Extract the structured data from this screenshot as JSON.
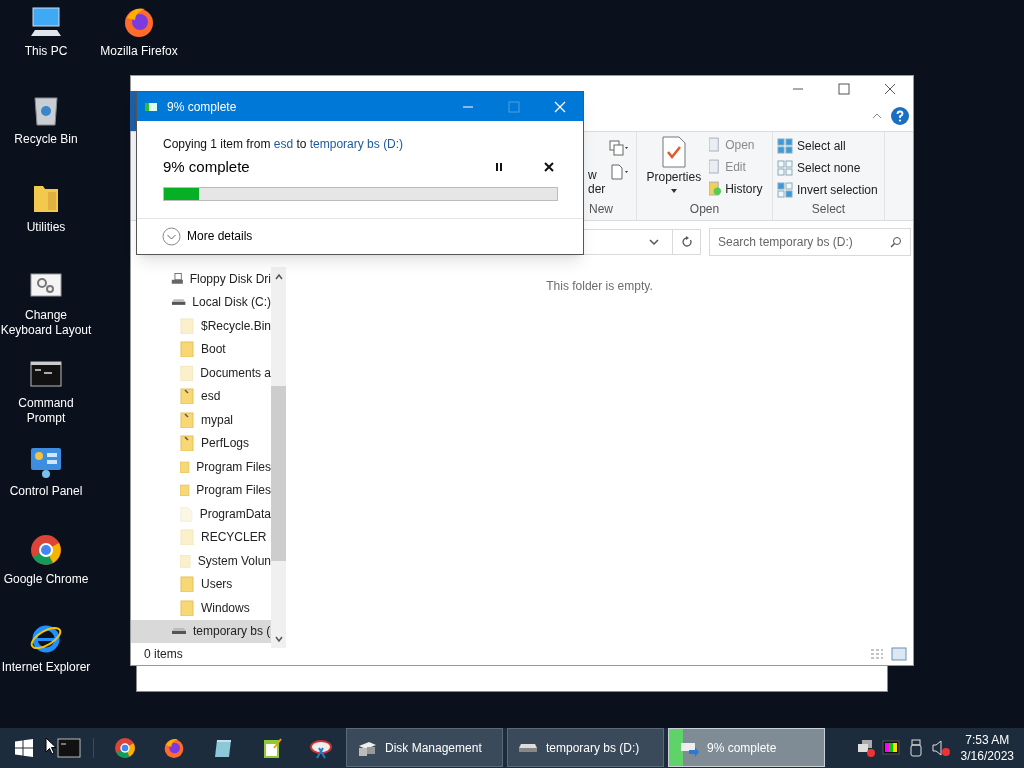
{
  "desktop_icons": [
    {
      "label": "This PC",
      "kind": "pc"
    },
    {
      "label": "Recycle Bin",
      "kind": "recycle"
    },
    {
      "label": "Utilities",
      "kind": "folder"
    },
    {
      "label": "Change Keyboard Layout",
      "kind": "gears"
    },
    {
      "label": "Command Prompt",
      "kind": "cmd"
    },
    {
      "label": "Control Panel",
      "kind": "control"
    },
    {
      "label": "Google Chrome",
      "kind": "chrome"
    },
    {
      "label": "Internet Explorer",
      "kind": "ie"
    },
    {
      "label": "Mozilla Firefox",
      "kind": "firefox"
    }
  ],
  "explorer": {
    "ribbon": {
      "new_group": {
        "label": "New",
        "fragment": [
          "w",
          "der"
        ]
      },
      "open_group": {
        "label": "Open",
        "properties": "Properties",
        "items": [
          {
            "label": "Open",
            "kind": "open",
            "disabled": true
          },
          {
            "label": "Edit",
            "kind": "edit",
            "disabled": true
          },
          {
            "label": "History",
            "kind": "history",
            "disabled": false
          }
        ]
      },
      "select_group": {
        "label": "Select",
        "items": [
          {
            "label": "Select all",
            "kind": "all"
          },
          {
            "label": "Select none",
            "kind": "none"
          },
          {
            "label": "Invert selection",
            "kind": "invert"
          }
        ]
      }
    },
    "search": {
      "placeholder": "Search temporary bs (D:)"
    },
    "nav": [
      {
        "label": "Floppy Disk Dri",
        "kind": "floppy",
        "selected": false
      },
      {
        "label": "Local Disk (C:)",
        "kind": "drive",
        "selected": false,
        "children": [
          {
            "label": "$Recycle.Bin",
            "kind": "hidden-folder",
            "selected": false
          },
          {
            "label": "Boot",
            "kind": "folder",
            "selected": false
          },
          {
            "label": "Documents a",
            "kind": "hidden-folder",
            "selected": false
          },
          {
            "label": "esd",
            "kind": "marked-folder",
            "selected": false
          },
          {
            "label": "mypal",
            "kind": "marked-folder",
            "selected": false
          },
          {
            "label": "PerfLogs",
            "kind": "marked-folder",
            "selected": false
          },
          {
            "label": "Program Files",
            "kind": "folder",
            "selected": false
          },
          {
            "label": "Program Files",
            "kind": "folder",
            "selected": false
          },
          {
            "label": "ProgramData",
            "kind": "hidden-file",
            "selected": false
          },
          {
            "label": "RECYCLER",
            "kind": "hidden-folder",
            "selected": false
          },
          {
            "label": "System Volun",
            "kind": "hidden-folder",
            "selected": false
          },
          {
            "label": "Users",
            "kind": "folder",
            "selected": false
          },
          {
            "label": "Windows",
            "kind": "folder",
            "selected": false
          }
        ]
      },
      {
        "label": "temporary bs (",
        "kind": "drive",
        "selected": true
      }
    ],
    "empty_text": "This folder is empty.",
    "status": "0 items"
  },
  "dialog": {
    "title": "9% complete",
    "maximize_disabled": true,
    "message": [
      {
        "text": "Copying 1 item from ",
        "kind": "plain"
      },
      {
        "text": "esd",
        "kind": "link"
      },
      {
        "text": " to ",
        "kind": "plain"
      },
      {
        "text": "temporary bs (D:)",
        "kind": "link"
      }
    ],
    "status": "9% complete",
    "level": 0.09,
    "more_details": "More details"
  },
  "taskbar": {
    "pinned": [
      {
        "kind": "cmd"
      },
      {
        "kind": "chrome"
      },
      {
        "kind": "firefox"
      },
      {
        "kind": "notepad"
      },
      {
        "kind": "editor"
      },
      {
        "kind": "snip"
      }
    ],
    "windows": [
      {
        "label": "Disk Management",
        "kind": "disk",
        "selected": false
      },
      {
        "label": "temporary bs (D:)",
        "kind": "drive",
        "selected": false
      },
      {
        "label": "9% complete",
        "kind": "copy",
        "selected": true,
        "level": 0.09
      }
    ],
    "tray": [
      {
        "kind": "network"
      },
      {
        "kind": "color"
      },
      {
        "kind": "usb"
      },
      {
        "kind": "volume"
      }
    ],
    "time": "7:53 AM",
    "date": "3/16/2023"
  }
}
